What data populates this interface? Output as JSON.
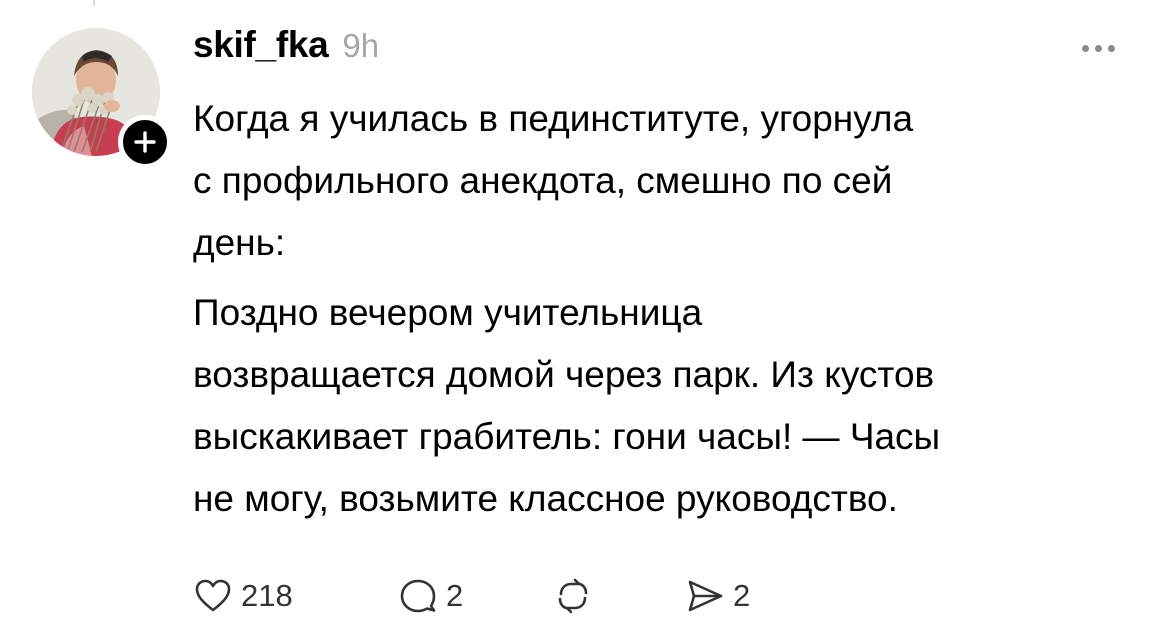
{
  "post": {
    "username": "skif_fka",
    "timestamp": "9h",
    "paragraph_1": [
      "Когда я училась в пединституте, угорнула",
      "с профильного анекдота, смешно по сей",
      "день:"
    ],
    "paragraph_2": [
      "Поздно вечером учительница",
      "возвращается домой через парк. Из кустов",
      "выскакивает грабитель: гони часы! — Часы",
      "не могу, возьмите классное руководство."
    ]
  },
  "actions": {
    "like_count": "218",
    "reply_count": "2",
    "share_count": "2"
  },
  "icons": {
    "like": "heart-icon",
    "reply": "comment-bubble-icon",
    "repost": "repost-arrows-icon",
    "share": "send-icon",
    "follow": "plus-icon",
    "more": "more-dots-icon"
  },
  "colors": {
    "text": "#000000",
    "muted": "#a6a6a6",
    "icon": "#333333",
    "badge": "#000000"
  }
}
